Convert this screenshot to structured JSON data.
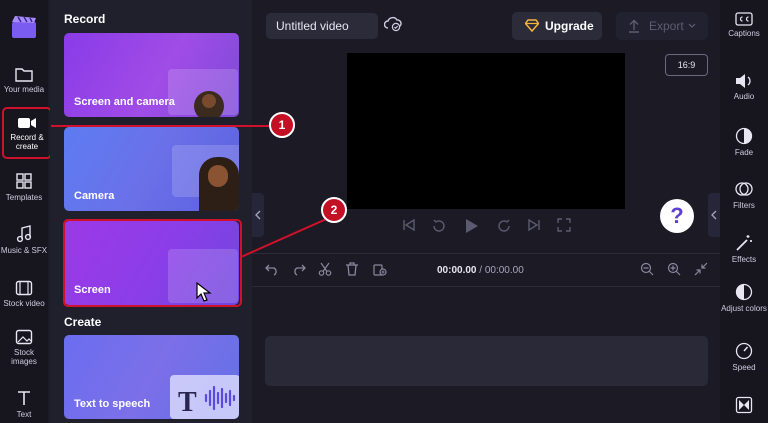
{
  "leftnav": {
    "items": [
      {
        "label": "Your media",
        "icon": "folder-icon"
      },
      {
        "label": "Record & create",
        "icon": "video-camera-icon"
      },
      {
        "label": "Templates",
        "icon": "templates-icon"
      },
      {
        "label": "Music & SFX",
        "icon": "music-note-icon"
      },
      {
        "label": "Stock video",
        "icon": "film-icon"
      },
      {
        "label": "Stock images",
        "icon": "image-icon"
      },
      {
        "label": "Text",
        "icon": "text-icon"
      }
    ]
  },
  "panel": {
    "record_title": "Record",
    "create_title": "Create",
    "cards": [
      {
        "label": "Screen and camera"
      },
      {
        "label": "Camera"
      },
      {
        "label": "Screen"
      },
      {
        "label": "Text to speech"
      }
    ]
  },
  "topbar": {
    "title": "Untitled video",
    "upgrade": "Upgrade",
    "export": "Export"
  },
  "preview": {
    "ratio": "16:9",
    "help": "?"
  },
  "timeline": {
    "current": "00:00.00",
    "separator": " / ",
    "total": "00:00.00"
  },
  "rightnav": {
    "items": [
      {
        "label": "Captions",
        "icon": "captions-icon"
      },
      {
        "label": "Audio",
        "icon": "speaker-icon"
      },
      {
        "label": "Fade",
        "icon": "fade-icon"
      },
      {
        "label": "Filters",
        "icon": "filters-icon"
      },
      {
        "label": "Effects",
        "icon": "effects-wand-icon"
      },
      {
        "label": "Adjust colors",
        "icon": "adjust-colors-icon"
      },
      {
        "label": "Speed",
        "icon": "speedometer-icon"
      }
    ]
  },
  "annotations": {
    "step1": "1",
    "step2": "2"
  },
  "colors": {
    "accent_red": "#d0112b",
    "brand_purple": "#7d4ad8"
  }
}
